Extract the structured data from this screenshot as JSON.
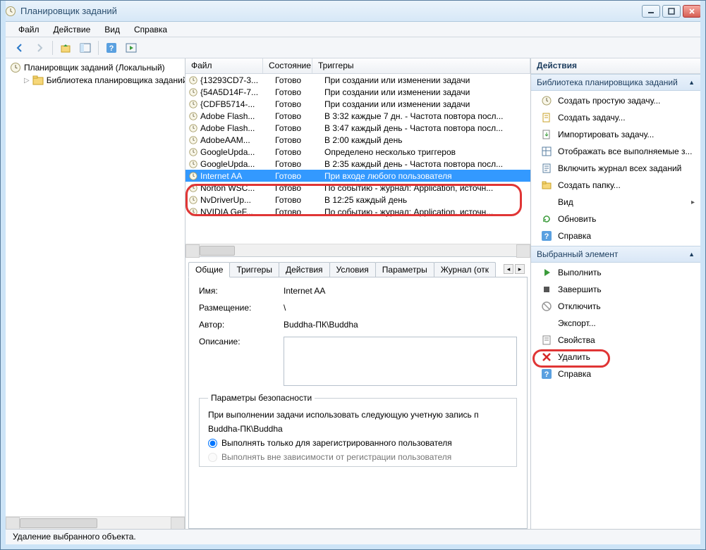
{
  "window": {
    "title": "Планировщик заданий"
  },
  "menu": {
    "file": "Файл",
    "action": "Действие",
    "view": "Вид",
    "help": "Справка"
  },
  "tree": {
    "root": "Планировщик заданий (Локальный)",
    "library": "Библиотека планировщика заданий"
  },
  "grid": {
    "cols": {
      "file": "Файл",
      "state": "Состояние",
      "triggers": "Триггеры"
    },
    "rows": [
      {
        "name": "{13293CD7-3...",
        "state": "Готово",
        "trigger": "При создании или изменении задачи"
      },
      {
        "name": "{54A5D14F-7...",
        "state": "Готово",
        "trigger": "При создании или изменении задачи"
      },
      {
        "name": "{CDFB5714-...",
        "state": "Готово",
        "trigger": "При создании или изменении задачи"
      },
      {
        "name": "Adobe Flash...",
        "state": "Готово",
        "trigger": "В 3:32 каждые 7 дн. - Частота повтора посл..."
      },
      {
        "name": "Adobe Flash...",
        "state": "Готово",
        "trigger": "В 3:47 каждый день - Частота повтора посл..."
      },
      {
        "name": "AdobeAAM...",
        "state": "Готово",
        "trigger": "В 2:00 каждый день"
      },
      {
        "name": "GoogleUpda...",
        "state": "Готово",
        "trigger": "Определено несколько триггеров"
      },
      {
        "name": "GoogleUpda...",
        "state": "Готово",
        "trigger": "В 2:35 каждый день - Частота повтора посл..."
      },
      {
        "name": "Internet AA",
        "state": "Готово",
        "trigger": "При входе любого пользователя",
        "selected": true
      },
      {
        "name": "Norton WSC...",
        "state": "Готово",
        "trigger": "По событию - журнал: Application, источн..."
      },
      {
        "name": "NvDriverUp...",
        "state": "Готово",
        "trigger": "В 12:25 каждый день"
      },
      {
        "name": "NVIDIA GeF...",
        "state": "Готово",
        "trigger": "По событию - журнал: Application, источн..."
      }
    ]
  },
  "tabs": {
    "general": "Общие",
    "triggers": "Триггеры",
    "actions": "Действия",
    "conditions": "Условия",
    "settings": "Параметры",
    "history": "Журнал (отк"
  },
  "details": {
    "name_label": "Имя:",
    "name_value": "Internet AA",
    "location_label": "Размещение:",
    "location_value": "\\",
    "author_label": "Автор:",
    "author_value": "Buddha-ПК\\Buddha",
    "desc_label": "Описание:",
    "sec_legend": "Параметры безопасности",
    "sec_text": "При выполнении задачи использовать следующую учетную запись п",
    "sec_account": "Buddha-ПК\\Buddha",
    "radio1": "Выполнять только для зарегистрированного пользователя",
    "radio2": "Выполнять вне зависимости от регистрации пользователя"
  },
  "actions": {
    "header": "Действия",
    "section_library": "Библиотека планировщика заданий",
    "items_library": [
      "Создать простую задачу...",
      "Создать задачу...",
      "Импортировать задачу...",
      "Отображать все выполняемые з...",
      "Включить журнал всех заданий",
      "Создать папку...",
      "Вид",
      "Обновить",
      "Справка"
    ],
    "section_selected": "Выбранный элемент",
    "items_selected": [
      "Выполнить",
      "Завершить",
      "Отключить",
      "Экспорт...",
      "Свойства",
      "Удалить",
      "Справка"
    ]
  },
  "status": "Удаление выбранного объекта."
}
